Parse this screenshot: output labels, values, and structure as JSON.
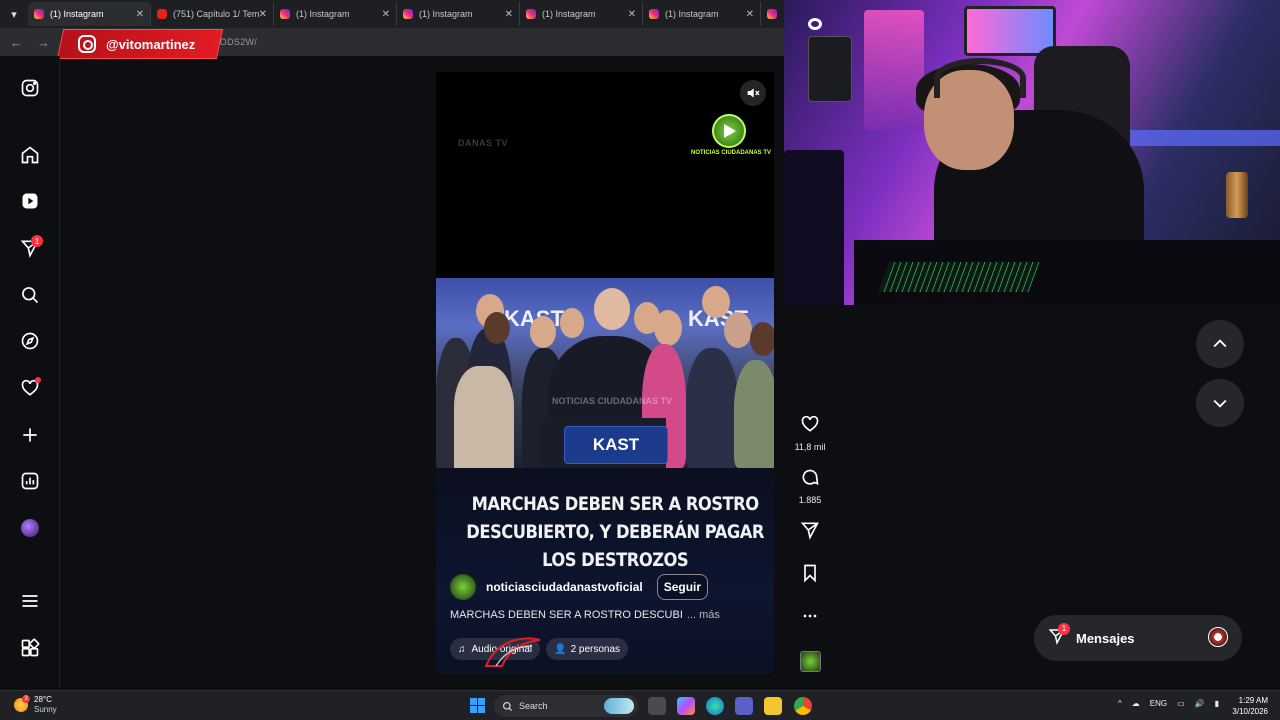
{
  "browser": {
    "tabs": [
      {
        "label": "(1) Instagram",
        "favicon": "instagram-icon",
        "active": true
      },
      {
        "label": "(751) Capítulo 1/ Tem",
        "favicon": "youtube-icon",
        "active": false
      },
      {
        "label": "(1) Instagram",
        "favicon": "instagram-icon",
        "active": false
      },
      {
        "label": "(1) Instagram",
        "favicon": "instagram-icon",
        "active": false
      },
      {
        "label": "(1) Instagram",
        "favicon": "instagram-icon",
        "active": false
      },
      {
        "label": "(1) Instagram",
        "favicon": "instagram-icon",
        "active": false
      }
    ],
    "url_fragment": "ZODS2W/"
  },
  "overlay": {
    "handle": "@vitomartinez",
    "accent": "#e31b23"
  },
  "sidebar": {
    "items": [
      {
        "icon": "instagram-logo-icon"
      },
      {
        "icon": "home-icon"
      },
      {
        "icon": "reels-icon"
      },
      {
        "icon": "direct-send-icon",
        "badge": "1"
      },
      {
        "icon": "search-icon"
      },
      {
        "icon": "explore-compass-icon"
      },
      {
        "icon": "heart-notifications-icon",
        "dot": true
      },
      {
        "icon": "create-plus-icon"
      },
      {
        "icon": "dashboard-icon"
      },
      {
        "icon": "profile-avatar"
      },
      {
        "icon": "menu-icon"
      },
      {
        "icon": "more-apps-icon"
      }
    ]
  },
  "reel": {
    "watermark_top": "DANAS TV",
    "logo_text": "NOTICIAS CIUDADANAS TV",
    "scene_watermark": "NOTICIAS CIUDADANAS TV",
    "wall_text": "KAST",
    "sign_text": "KAST",
    "headline": "MARCHAS DEBEN SER A ROSTRO DESCUBIERTO, Y DEBERÁN PAGAR LOS DESTROZOS",
    "author": "noticiasciudadanastvoficial",
    "follow_label": "Seguir",
    "caption": "MARCHAS DEBEN SER A ROSTRO DESCUBI",
    "caption_more": "... más",
    "audio_label": "Audio original",
    "people_label": "2 personas"
  },
  "actions": {
    "likes": "11,8 mil",
    "comments": "1.885"
  },
  "messages": {
    "label": "Mensajes",
    "badge": "1"
  },
  "taskbar": {
    "weather_temp": "28°C",
    "weather_desc": "Sunny",
    "weather_badge": "3",
    "search_placeholder": "Search",
    "lang": "ENG",
    "time": "1:29 AM",
    "date": "3/10/2026"
  }
}
